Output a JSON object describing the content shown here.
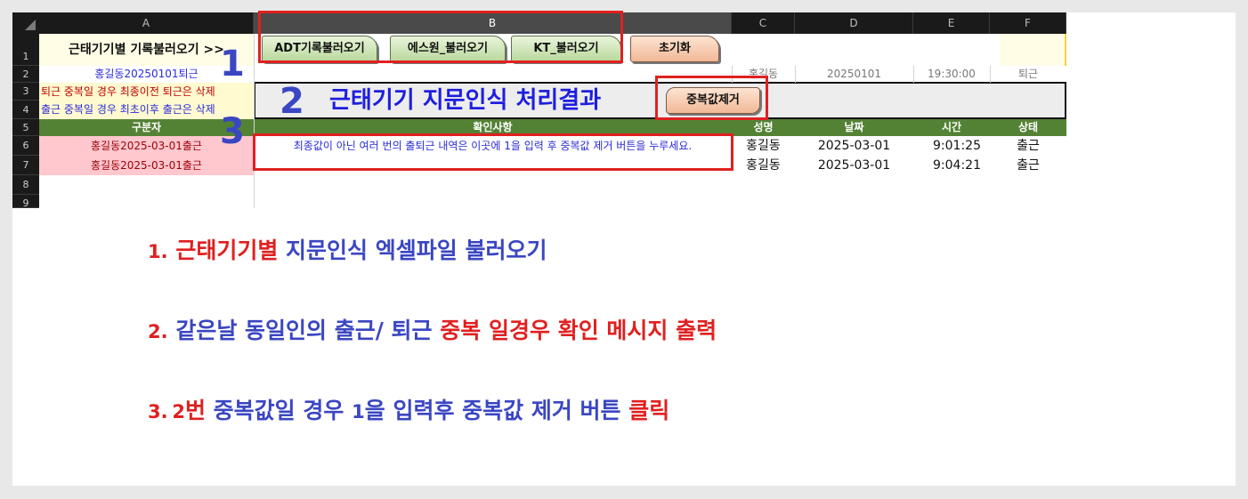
{
  "sheet": {
    "columns": [
      "A",
      "B",
      "C",
      "D",
      "E",
      "F"
    ],
    "rows": [
      "1",
      "2",
      "3",
      "4",
      "5",
      "6",
      "7",
      "8",
      "9"
    ],
    "title_cell": "근태기기별 기록불러오기 >>",
    "a2": "홍길동20250101퇴근",
    "a3": "퇴근 중복일 경우 최종이전 퇴근은 삭제",
    "a4": "출근 중복일 경우 최초이후 출근은 삭제",
    "row2": {
      "c": "홍길동",
      "d": "20250101",
      "e": "19:30:00",
      "f": "퇴근"
    },
    "result_title": "근태기기 지문인식 처리결과",
    "headers": {
      "a": "구분자",
      "b": "확인사항",
      "c": "성명",
      "d": "날짜",
      "e": "시간",
      "f": "상태"
    },
    "notice": "최종값이 아닌 여러 번의 출퇴근 내역은 이곳에 1을 입력 후 중복값 제거 버튼을 누루세요.",
    "data_rows": [
      {
        "key": "홍길동2025-03-01출근",
        "name": "홍길동",
        "date": "2025-03-01",
        "time": "9:01:25",
        "status": "출근"
      },
      {
        "key": "홍길동2025-03-01출근",
        "name": "홍길동",
        "date": "2025-03-01",
        "time": "9:04:21",
        "status": "출근"
      }
    ]
  },
  "buttons": {
    "adt": "ADT기록불러오기",
    "s1": "에스원_불러오기",
    "kt": "KT_불러오기",
    "reset": "초기화",
    "dedupe": "중복값제거"
  },
  "markers": {
    "m1": "1",
    "m2": "2",
    "m3": "3"
  },
  "instructions": {
    "l1": {
      "num": "1.",
      "red": "근태기기별",
      "rest": "지문인식 엑셀파일 불러오기"
    },
    "l2": {
      "num": "2.",
      "blue": "같은날 동일인의 출근/ 퇴근",
      "red": "중복 일경우 확인 메시지 출력"
    },
    "l3": {
      "num": "3.",
      "lead": "2",
      "red1": "번",
      "blue": "중복값일 경우",
      "one": "1",
      "blue2": "을 입력후 중복값 제거 버튼",
      "red2": "클릭"
    }
  },
  "colors": {
    "accent_red": "#e02020",
    "accent_blue": "#3a46c2",
    "header_green": "#548235",
    "pink_fill": "#ffc7ce"
  }
}
